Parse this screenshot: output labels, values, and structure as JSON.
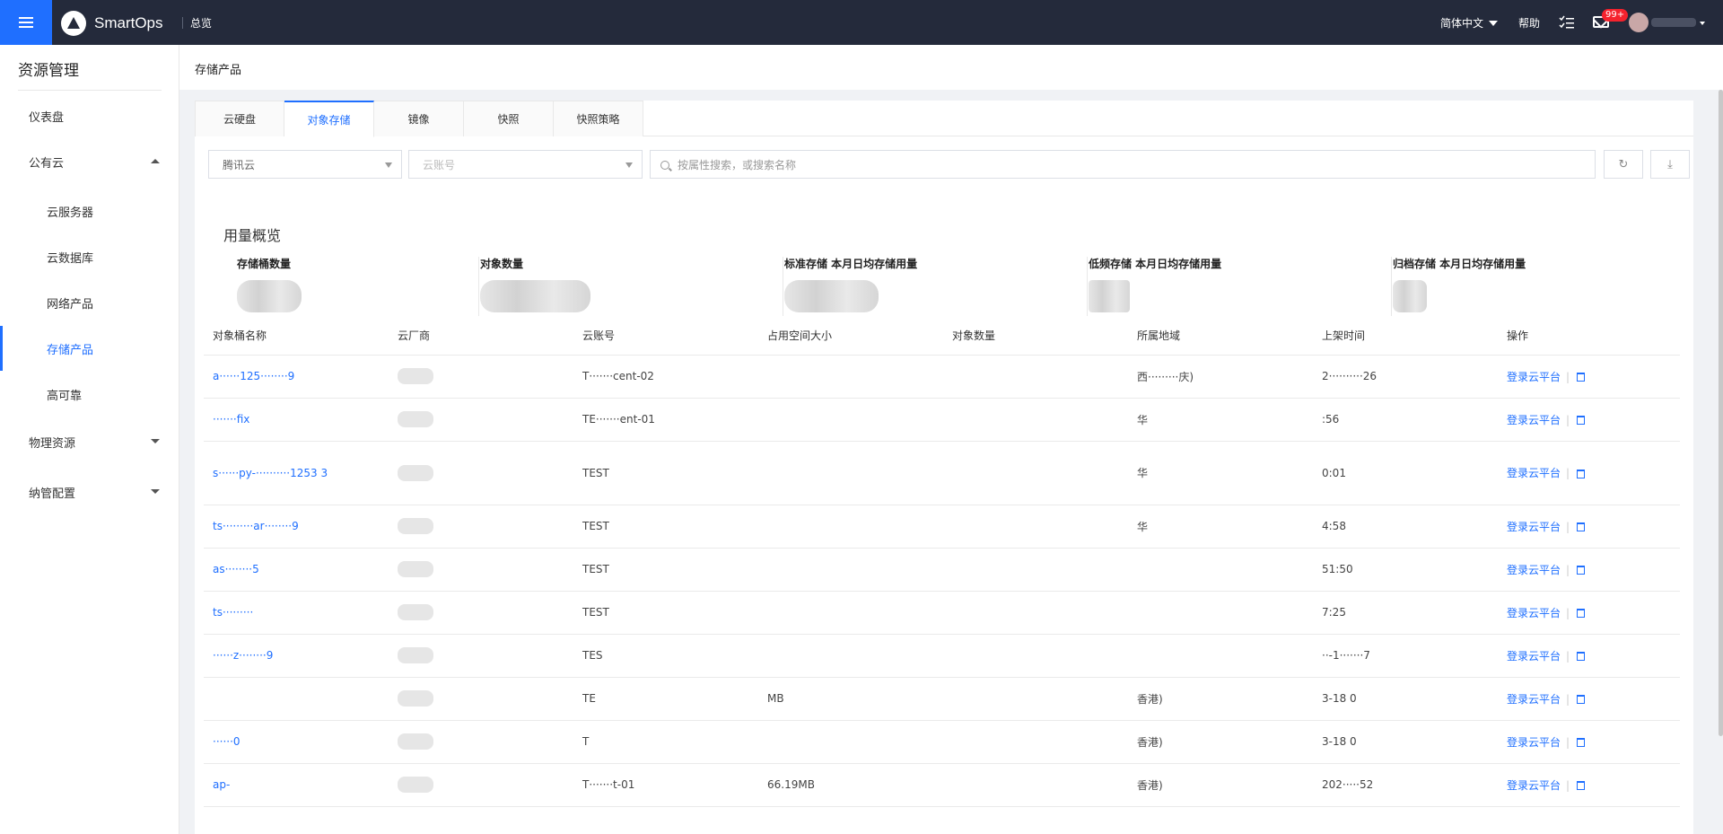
{
  "topbar": {
    "brand": "SmartOps",
    "overview": "总览",
    "language": "简体中文",
    "help": "帮助",
    "notification_count": "99+"
  },
  "sidebar": {
    "title": "资源管理",
    "items": [
      {
        "label": "仪表盘"
      },
      {
        "label": "公有云"
      },
      {
        "label": "云服务器"
      },
      {
        "label": "云数据库"
      },
      {
        "label": "网络产品"
      },
      {
        "label": "存储产品"
      },
      {
        "label": "高可靠"
      },
      {
        "label": "物理资源"
      },
      {
        "label": "纳管配置"
      }
    ]
  },
  "page": {
    "title": "存储产品",
    "tabs": [
      {
        "label": "云硬盘"
      },
      {
        "label": "对象存储"
      },
      {
        "label": "镜像"
      },
      {
        "label": "快照"
      },
      {
        "label": "快照策略"
      }
    ],
    "filters": {
      "provider": "腾讯云",
      "account_placeholder": "云账号",
      "search_placeholder": "按属性搜索，或搜索名称"
    }
  },
  "usage": {
    "title": "用量概览",
    "stats": [
      {
        "label": "存储桶数量"
      },
      {
        "label": "对象数量"
      },
      {
        "label": "标准存储 本月日均存储用量"
      },
      {
        "label": "低频存储 本月日均存储用量"
      },
      {
        "label": "归档存储 本月日均存储用量"
      }
    ]
  },
  "table": {
    "columns": [
      "对象桶名称",
      "云厂商",
      "云账号",
      "占用空间大小",
      "对象数量",
      "所属地域",
      "上架时间",
      "操作"
    ],
    "action_label": "登录云平台",
    "rows": [
      {
        "name": "a······125········9",
        "account": "T·······cent-02",
        "size": "",
        "region": "西·········庆)",
        "time": "2··········26"
      },
      {
        "name": "·······fix",
        "account": "TE·······ent-01",
        "size": "",
        "region": "华",
        "time": ":56"
      },
      {
        "name": "s······py-··········1253 3",
        "account": "TEST",
        "size": "",
        "region": "华",
        "time": "0:01"
      },
      {
        "name": "ts·········ar········9",
        "account": "TEST",
        "size": "",
        "region": "华",
        "time": "4:58"
      },
      {
        "name": "as········5",
        "account": "TEST",
        "size": "",
        "region": "",
        "time": "51:50"
      },
      {
        "name": "ts·········",
        "account": "TEST",
        "size": "",
        "region": "",
        "time": "7:25"
      },
      {
        "name": "······z········9",
        "account": "TES",
        "size": "",
        "region": "",
        "time": "··-1·······7"
      },
      {
        "name": "",
        "account": "TE",
        "size": "MB",
        "region": "香港)",
        "time": "3-18 0"
      },
      {
        "name": "······0",
        "account": "T",
        "size": "",
        "region": "香港)",
        "time": "3-18 0"
      },
      {
        "name": "ap-",
        "account": "T·······t-01",
        "size": "66.19MB",
        "region": "香港)",
        "time": "202·····52"
      }
    ]
  }
}
